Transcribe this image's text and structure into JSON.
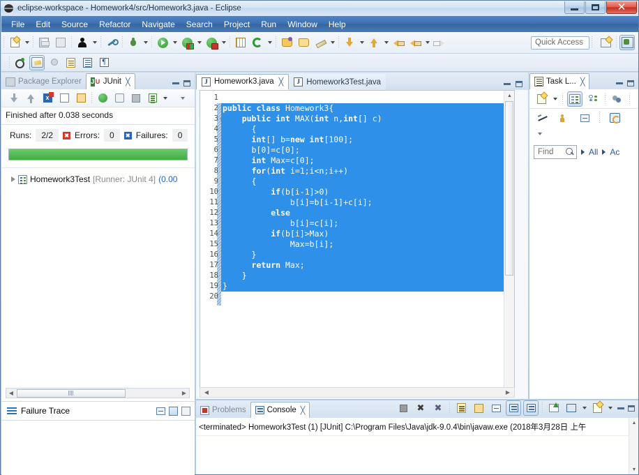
{
  "window": {
    "title": "eclipse-workspace - Homework4/src/Homework3.java - Eclipse",
    "icon": "eclipse-globe-icon",
    "minimize_label": "–",
    "maximize_label": "□",
    "close_label": "✕"
  },
  "menubar": {
    "items": [
      {
        "label": "File"
      },
      {
        "label": "Edit"
      },
      {
        "label": "Source"
      },
      {
        "label": "Refactor"
      },
      {
        "label": "Navigate"
      },
      {
        "label": "Search"
      },
      {
        "label": "Project"
      },
      {
        "label": "Run"
      },
      {
        "label": "Window"
      },
      {
        "label": "Help"
      }
    ]
  },
  "toolbar": {
    "quick_access_placeholder": "Quick Access",
    "buttons": [
      {
        "name": "new-wizard-icon"
      },
      {
        "name": "save-icon"
      },
      {
        "name": "save-all-icon"
      },
      {
        "name": "external-tools-icon"
      },
      {
        "name": "skip-breakpoints-icon"
      },
      {
        "name": "debug-icon"
      },
      {
        "name": "run-icon"
      },
      {
        "name": "run-configurations-icon"
      },
      {
        "name": "coverage-icon"
      },
      {
        "name": "new-java-package-icon"
      },
      {
        "name": "refresh-icon"
      },
      {
        "name": "open-type-icon"
      },
      {
        "name": "open-resource-icon"
      },
      {
        "name": "annotation-icon"
      },
      {
        "name": "next-annotation-icon"
      },
      {
        "name": "previous-annotation-icon"
      },
      {
        "name": "back-icon"
      },
      {
        "name": "forward-icon"
      }
    ],
    "perspective_buttons": [
      {
        "name": "open-perspective-icon"
      },
      {
        "name": "java-perspective-icon"
      }
    ]
  },
  "toolbar2": {
    "buttons": [
      {
        "name": "toggle-mark-occurrences-icon"
      },
      {
        "name": "toggle-highlight-icon"
      },
      {
        "name": "toggle-ant-icon"
      },
      {
        "name": "toggle-block-selection-icon"
      },
      {
        "name": "show-whitespace-icon"
      },
      {
        "name": "toggle-word-wrap-icon"
      }
    ]
  },
  "junit_view": {
    "tabs": [
      {
        "label": "Package Explorer",
        "icon": "package-explorer-icon",
        "active": false,
        "closable": false
      },
      {
        "label": "JUnit",
        "icon": "junit-icon",
        "active": true,
        "closable": true
      }
    ],
    "close_symbol": "╳",
    "toolbar": [
      {
        "name": "next-failure-icon"
      },
      {
        "name": "previous-failure-icon"
      },
      {
        "name": "show-failures-only-icon"
      },
      {
        "name": "scroll-lock-icon"
      },
      {
        "name": "activate-on-error-icon"
      },
      {
        "name": "rerun-test-icon"
      },
      {
        "name": "rerun-failed-tests-icon"
      },
      {
        "name": "stop-test-icon"
      },
      {
        "name": "test-run-history-icon"
      },
      {
        "name": "view-menu-arrow-icon"
      },
      {
        "name": "view-menu-icon"
      }
    ],
    "status_text": "Finished after 0.038 seconds",
    "counters": {
      "runs_label": "Runs:",
      "runs_value": "2/2",
      "errors_label": "Errors:",
      "errors_value": "0",
      "failures_label": "Failures:",
      "failures_value": "0",
      "errors_badge": "✖",
      "failures_badge": "✖"
    },
    "progress": {
      "percent": 100,
      "color": "#3fae3f"
    },
    "tree": [
      {
        "name": "Homework3Test",
        "runner": "[Runner: JUnit 4]",
        "time": "(0.00"
      }
    ],
    "failure_trace": {
      "label": "Failure Trace",
      "buttons": [
        {
          "name": "filter-stack-trace-icon"
        },
        {
          "name": "compare-result-icon"
        },
        {
          "name": "view-menu-icon"
        }
      ]
    }
  },
  "editor": {
    "tabs": [
      {
        "label": "Homework3.java",
        "icon": "java-file-icon",
        "active": true,
        "closable": true
      },
      {
        "label": "Homework3Test.java",
        "icon": "java-file-icon",
        "active": false,
        "closable": false
      }
    ],
    "close_symbol": "╳",
    "code": {
      "language": "java",
      "selection_start_line": 2,
      "selection_end_line": 19,
      "lines": [
        {
          "num": 1,
          "text": "",
          "selected": false,
          "fold": false
        },
        {
          "num": 2,
          "text": "public class Homework3{",
          "selected": true,
          "fold": false
        },
        {
          "num": 3,
          "text": "    public int MAX(int n,int[] c)",
          "selected": true,
          "fold": true
        },
        {
          "num": 4,
          "text": "      {",
          "selected": true,
          "fold": false
        },
        {
          "num": 5,
          "text": "      int[] b=new int[100];",
          "selected": true,
          "fold": false
        },
        {
          "num": 6,
          "text": "      b[0]=c[0];",
          "selected": true,
          "fold": false
        },
        {
          "num": 7,
          "text": "      int Max=c[0];",
          "selected": true,
          "fold": false
        },
        {
          "num": 8,
          "text": "      for(int i=1;i<n;i++)",
          "selected": true,
          "fold": false
        },
        {
          "num": 9,
          "text": "      {",
          "selected": true,
          "fold": false
        },
        {
          "num": 10,
          "text": "          if(b[i-1]>0)",
          "selected": true,
          "fold": false
        },
        {
          "num": 11,
          "text": "              b[i]=b[i-1]+c[i];",
          "selected": true,
          "fold": false
        },
        {
          "num": 12,
          "text": "          else",
          "selected": true,
          "fold": false
        },
        {
          "num": 13,
          "text": "              b[i]=c[i];",
          "selected": true,
          "fold": false
        },
        {
          "num": 14,
          "text": "          if(b[i]>Max)",
          "selected": true,
          "fold": false
        },
        {
          "num": 15,
          "text": "              Max=b[i];",
          "selected": true,
          "fold": false
        },
        {
          "num": 16,
          "text": "      }",
          "selected": true,
          "fold": false
        },
        {
          "num": 17,
          "text": "      return Max;",
          "selected": true,
          "fold": false
        },
        {
          "num": 18,
          "text": "    }",
          "selected": true,
          "fold": false
        },
        {
          "num": 19,
          "text": "}",
          "selected": true,
          "fold": false
        },
        {
          "num": 20,
          "text": "",
          "selected": false,
          "fold": false
        }
      ]
    },
    "selection_color": "#2e90e8",
    "controls": [
      {
        "name": "minimize-editor-icon"
      },
      {
        "name": "maximize-editor-icon"
      }
    ]
  },
  "task_list": {
    "tab": {
      "label": "Task L...",
      "icon": "task-list-icon",
      "closable": true
    },
    "close_symbol": "╳",
    "toolbar_row1": [
      {
        "name": "new-task-icon"
      },
      {
        "name": "new-task-dropdown-icon"
      },
      {
        "name": "categorized-presentation-icon"
      },
      {
        "name": "scheduled-presentation-icon"
      },
      {
        "name": "synchronize-changed-icon"
      }
    ],
    "toolbar_row2": [
      {
        "name": "focus-on-workweek-icon"
      },
      {
        "name": "show-all-tasks-icon"
      },
      {
        "name": "collapse-all-icon"
      },
      {
        "name": "restore-tasks-icon"
      }
    ],
    "toolbar_row3": [
      {
        "name": "view-menu-arrow-icon"
      }
    ],
    "find": {
      "placeholder": "Find",
      "search_icon": "search-icon",
      "filters": [
        {
          "label": "All"
        },
        {
          "label": "Ac"
        }
      ]
    }
  },
  "console": {
    "tabs": [
      {
        "label": "Problems",
        "icon": "problems-icon",
        "active": false,
        "closable": false
      },
      {
        "label": "Console",
        "icon": "console-icon",
        "active": true,
        "closable": true
      }
    ],
    "close_symbol": "╳",
    "toolbar": [
      {
        "name": "terminate-icon"
      },
      {
        "name": "remove-launch-icon"
      },
      {
        "name": "remove-all-terminated-icon"
      },
      {
        "name": "clear-console-icon"
      },
      {
        "name": "scroll-lock-icon"
      },
      {
        "name": "word-wrap-icon"
      },
      {
        "name": "show-console-on-output-icon"
      },
      {
        "name": "show-console-on-error-icon"
      },
      {
        "name": "pin-console-icon"
      },
      {
        "name": "display-selected-console-icon"
      },
      {
        "name": "display-console-dropdown-icon"
      },
      {
        "name": "open-console-icon"
      },
      {
        "name": "open-console-dropdown-icon"
      },
      {
        "name": "minimize-console-icon"
      },
      {
        "name": "maximize-console-icon"
      }
    ],
    "output_line": "<terminated> Homework3Test (1) [JUnit] C:\\Program Files\\Java\\jdk-9.0.4\\bin\\javaw.exe (2018年3月28日 上午"
  }
}
